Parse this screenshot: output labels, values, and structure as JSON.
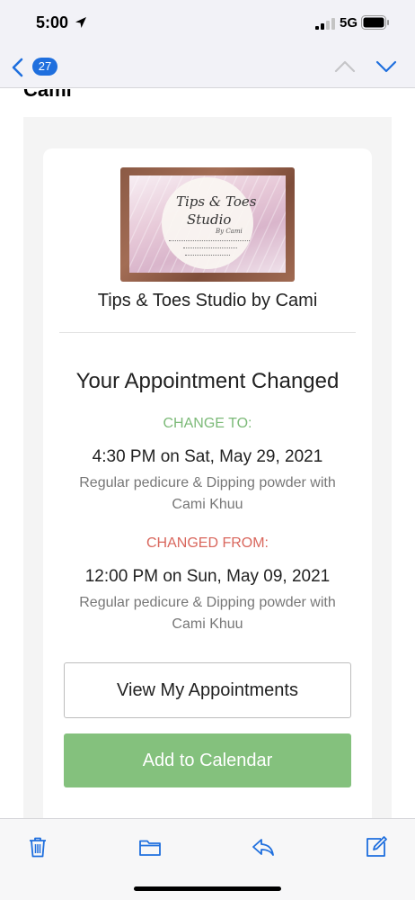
{
  "status_bar": {
    "time": "5:00",
    "network": "5G",
    "icons": [
      "location-arrow-icon",
      "signal-bars-icon",
      "battery-icon"
    ]
  },
  "nav": {
    "back_icon": "chevron-left-icon",
    "unread_count": "27",
    "up_icon": "chevron-up-icon",
    "down_icon": "chevron-down-icon"
  },
  "email": {
    "sender_peek": "Cami",
    "business_card": {
      "logo_line1": "Tips & Toes",
      "logo_line2": "Studio",
      "logo_line3": "By Cami"
    },
    "business_name": "Tips & Toes Studio by Cami",
    "headline": "Your Appointment Changed",
    "change_to_label": "CHANGE TO:",
    "new_time": "4:30 PM on Sat, May 29, 2021",
    "new_service_line1": "Regular pedicure & Dipping powder with",
    "new_service_line2": "Cami Khuu",
    "changed_from_label": "CHANGED FROM:",
    "old_time": "12:00 PM on Sun, May 09, 2021",
    "old_service_line1": "Regular pedicure & Dipping powder with",
    "old_service_line2": "Cami Khuu",
    "view_button": "View My Appointments",
    "calendar_button": "Add to Calendar"
  },
  "toolbar": {
    "icons": [
      "trash-icon",
      "folder-icon",
      "reply-icon",
      "compose-icon"
    ]
  },
  "colors": {
    "accent_blue": "#1f6fde",
    "change_to_green": "#7cba78",
    "changed_from_red": "#d9675d",
    "calendar_button_green": "#84c17d"
  }
}
